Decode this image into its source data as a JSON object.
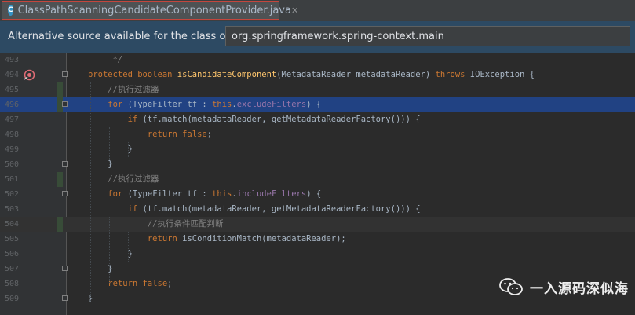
{
  "tab": {
    "title": "ClassPathScanningCandidateComponentProvider.java",
    "close": "✕",
    "icon": "C"
  },
  "notice": {
    "text": "Alternative source available for the class org....",
    "selected": "org.springframework.spring-context.main"
  },
  "lines": [
    {
      "num": "493",
      "html": "<span class=\"cmi\">     */</span>"
    },
    {
      "num": "494",
      "html": "<span class=\"kw\">protected boolean </span><span class=\"fn\">isCandidateComponent</span>(MetadataReader metadataReader) <span class=\"kw\">throws </span>IOException {"
    },
    {
      "num": "495",
      "html": "    <span class=\"cm\">//执行过滤器</span>"
    },
    {
      "num": "496",
      "html": "    <span class=\"kw\">for </span>(TypeFilter tf : <span class=\"kw\">this</span>.<span class=\"fld\">excludeFilters</span>) {"
    },
    {
      "num": "497",
      "html": "        <span class=\"kw\">if </span>(tf.match(metadataReader, getMetadataReaderFactory())) {"
    },
    {
      "num": "498",
      "html": "            <span class=\"kw\">return false</span>;"
    },
    {
      "num": "499",
      "html": "        }"
    },
    {
      "num": "500",
      "html": "    }"
    },
    {
      "num": "501",
      "html": "    <span class=\"cm\">//执行过滤器</span>"
    },
    {
      "num": "502",
      "html": "    <span class=\"kw\">for </span>(TypeFilter tf : <span class=\"kw\">this</span>.<span class=\"fld\">includeFilters</span>) {"
    },
    {
      "num": "503",
      "html": "        <span class=\"kw\">if </span>(tf.match(metadataReader, getMetadataReaderFactory())) {"
    },
    {
      "num": "504",
      "html": "            <span class=\"cm\">//执行条件匹配判断</span>"
    },
    {
      "num": "505",
      "html": "            <span class=\"kw\">return </span>isConditionMatch(metadataReader);"
    },
    {
      "num": "506",
      "html": "        }"
    },
    {
      "num": "507",
      "html": "    }"
    },
    {
      "num": "508",
      "html": "    <span class=\"kw\">return false</span>;"
    },
    {
      "num": "509",
      "html": "}"
    }
  ],
  "watermark": "一入源码深似海",
  "colors": {
    "selection": "#214283",
    "keyword": "#cc7832",
    "method": "#ffc66d",
    "field": "#9876aa",
    "comment": "#808080",
    "notice_bg": "#2d4a63"
  }
}
